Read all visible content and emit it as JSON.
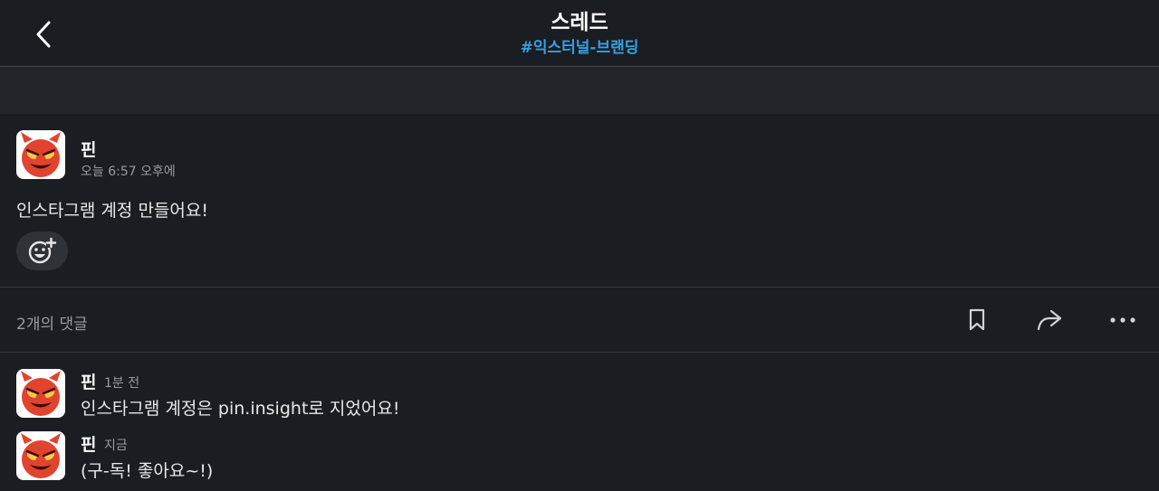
{
  "header": {
    "title": "스레드",
    "channel": "#익스터널-브랜딩",
    "back_icon": "chevron-left-icon"
  },
  "message": {
    "author": "핀",
    "time": "오늘 6:57 오후에",
    "text": "인스타그램 계정 만들어요!",
    "add_reaction_icon": "add-emoji-icon"
  },
  "reply_bar": {
    "count_label": "2개의 댓글",
    "icons": [
      "bookmark-icon",
      "share-icon",
      "more-icon"
    ]
  },
  "replies": [
    {
      "author": "핀",
      "time": "1분 전",
      "text": "인스타그램 계정은 pin.insight로 지었어요!"
    },
    {
      "author": "핀",
      "time": "지금",
      "text": "(구-독! 좋아요~!)"
    }
  ],
  "colors": {
    "background": "#1a1d21",
    "channel_link": "#36a0e6",
    "avatar_devil": "#e0442e"
  }
}
